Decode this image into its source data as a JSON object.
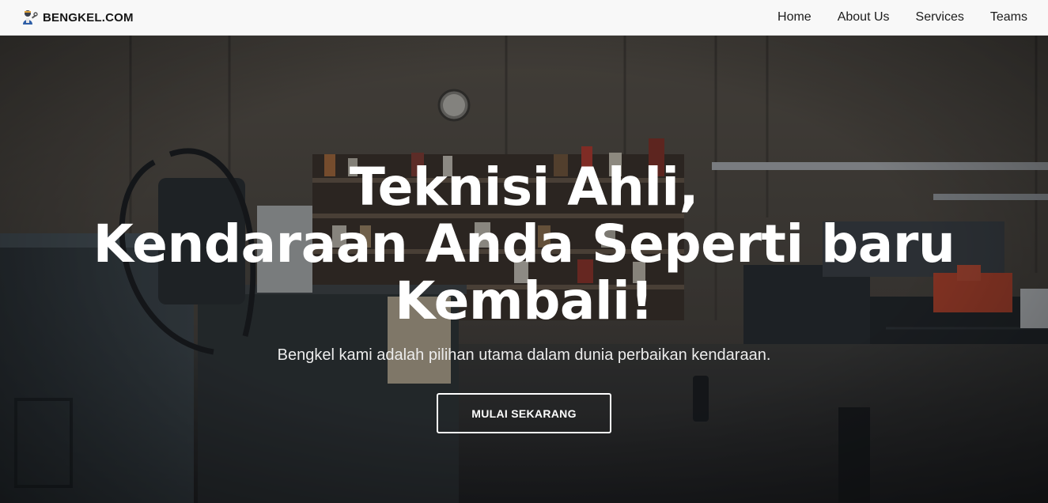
{
  "navbar": {
    "brand_name": "BENGKEL.COM",
    "brand_icon": "mechanic-icon",
    "links": [
      {
        "label": "Home"
      },
      {
        "label": "About Us"
      },
      {
        "label": "Services"
      },
      {
        "label": "Teams"
      }
    ]
  },
  "hero": {
    "title_lines": [
      "Teknisi Ahli,",
      "Kendaraan Anda Seperti baru",
      "Kembali!"
    ],
    "subtitle": "Bengkel kami adalah pilihan utama dalam dunia perbaikan kendaraan.",
    "cta_label": "MULAI SEKARANG"
  }
}
